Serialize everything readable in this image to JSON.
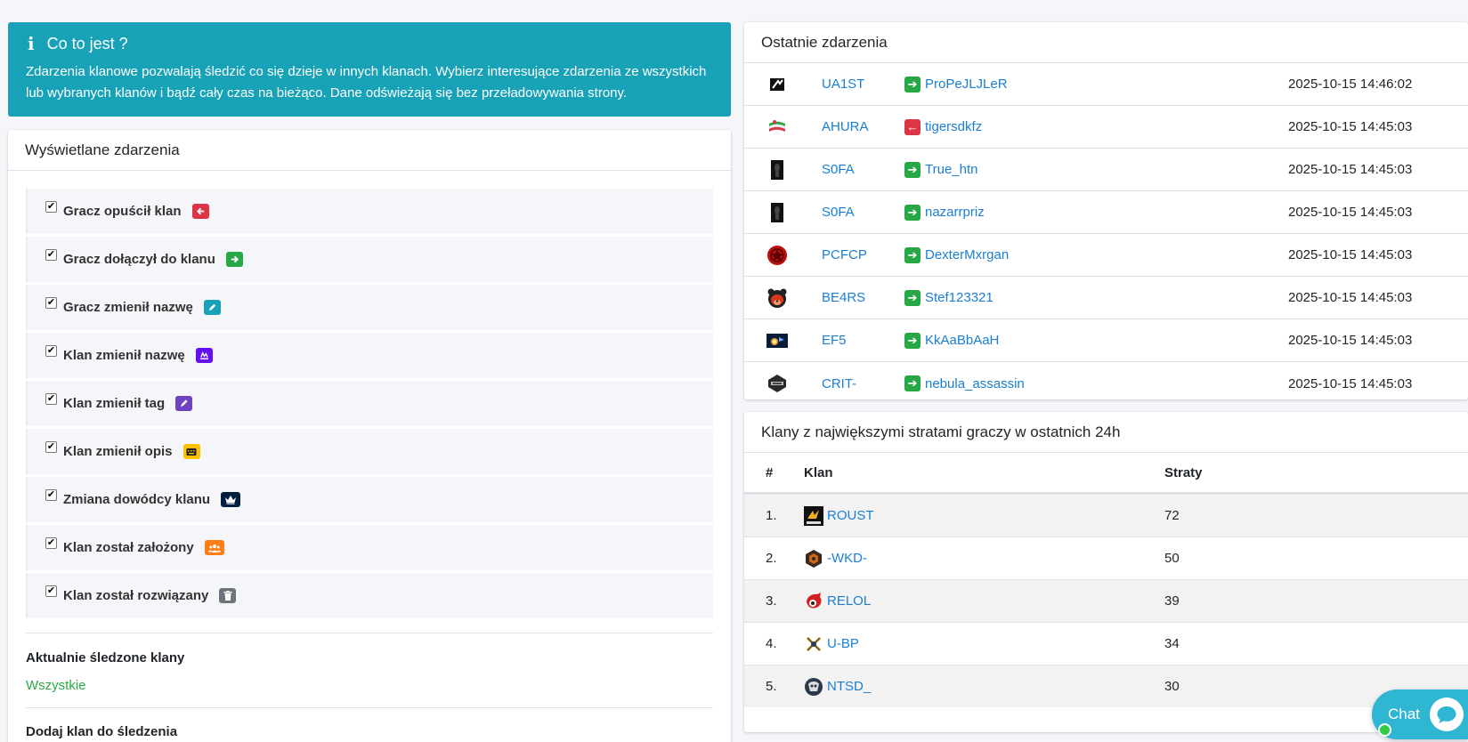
{
  "info": {
    "title": "Co to jest ?",
    "line1": "Zdarzenia klanowe pozwalają śledzić co się dzieje w innych klanach. Wybierz interesujące zdarzenia ze wszystkich",
    "line2": "lub wybranych klanów i bądź cały czas na bieżąco. Dane odświeżają się bez przeładowywania strony."
  },
  "events_panel": {
    "title": "Wyświetlane zdarzenia",
    "options": [
      {
        "label": "Gracz opuścił klan",
        "icon": "arrow-left-icon",
        "color": "#dc3545",
        "checked": true
      },
      {
        "label": "Gracz dołączył do klanu",
        "icon": "arrow-right-icon",
        "color": "#28a745",
        "checked": true
      },
      {
        "label": "Gracz zmienił nazwę",
        "icon": "pencil-icon",
        "color": "#17a2b8",
        "checked": true
      },
      {
        "label": "Klan zmienił nazwę",
        "icon": "signature-icon",
        "color": "#6610f2",
        "checked": true
      },
      {
        "label": "Klan zmienił tag",
        "icon": "pen-icon",
        "color": "#6f42c1",
        "checked": true
      },
      {
        "label": "Klan zmienił opis",
        "icon": "keyboard-icon",
        "color": "#ffc107",
        "checked": true
      },
      {
        "label": "Zmiana dowódcy klanu",
        "icon": "crown-icon",
        "color": "#001f3f",
        "checked": true
      },
      {
        "label": "Klan został założony",
        "icon": "users-icon",
        "color": "#fd7e14",
        "checked": true
      },
      {
        "label": "Klan został rozwiązany",
        "icon": "trash-icon",
        "color": "#6c757d",
        "checked": true
      }
    ],
    "tracked_title": "Aktualnie śledzone klany",
    "tracked_value": "Wszystkie",
    "add_title": "Dodaj klan do śledzenia"
  },
  "recent": {
    "title": "Ostatnie zdarzenia",
    "rows": [
      {
        "tag": "UA1ST",
        "type": "join",
        "player": "ProPeJLJLeR",
        "time": "2025-10-15 14:46:02"
      },
      {
        "tag": "AHURA",
        "type": "leave",
        "player": "tigersdkfz",
        "time": "2025-10-15 14:45:03"
      },
      {
        "tag": "S0FA",
        "type": "join",
        "player": "True_htn",
        "time": "2025-10-15 14:45:03"
      },
      {
        "tag": "S0FA",
        "type": "join",
        "player": "nazarrpriz",
        "time": "2025-10-15 14:45:03"
      },
      {
        "tag": "PCFCP",
        "type": "join",
        "player": "DexterMxrgan",
        "time": "2025-10-15 14:45:03"
      },
      {
        "tag": "BE4RS",
        "type": "join",
        "player": "Stef123321",
        "time": "2025-10-15 14:45:03"
      },
      {
        "tag": "EF5",
        "type": "join",
        "player": "KkAaBbAaH",
        "time": "2025-10-15 14:45:03"
      },
      {
        "tag": "CRIT-",
        "type": "join",
        "player": "nebula_assassin",
        "time": "2025-10-15 14:45:03"
      }
    ]
  },
  "losses": {
    "title": "Klany z największymi stratami graczy w ostatnich 24h",
    "headers": {
      "rank": "#",
      "clan": "Klan",
      "losses": "Straty"
    },
    "rows": [
      {
        "rank": "1.",
        "clan": "ROUST",
        "losses": "72"
      },
      {
        "rank": "2.",
        "clan": "-WKD-",
        "losses": "50"
      },
      {
        "rank": "3.",
        "clan": "RELOL",
        "losses": "39"
      },
      {
        "rank": "4.",
        "clan": "U-BP",
        "losses": "34"
      },
      {
        "rank": "5.",
        "clan": "NTSD_",
        "losses": "30"
      }
    ]
  },
  "chat": {
    "label": "Chat"
  }
}
